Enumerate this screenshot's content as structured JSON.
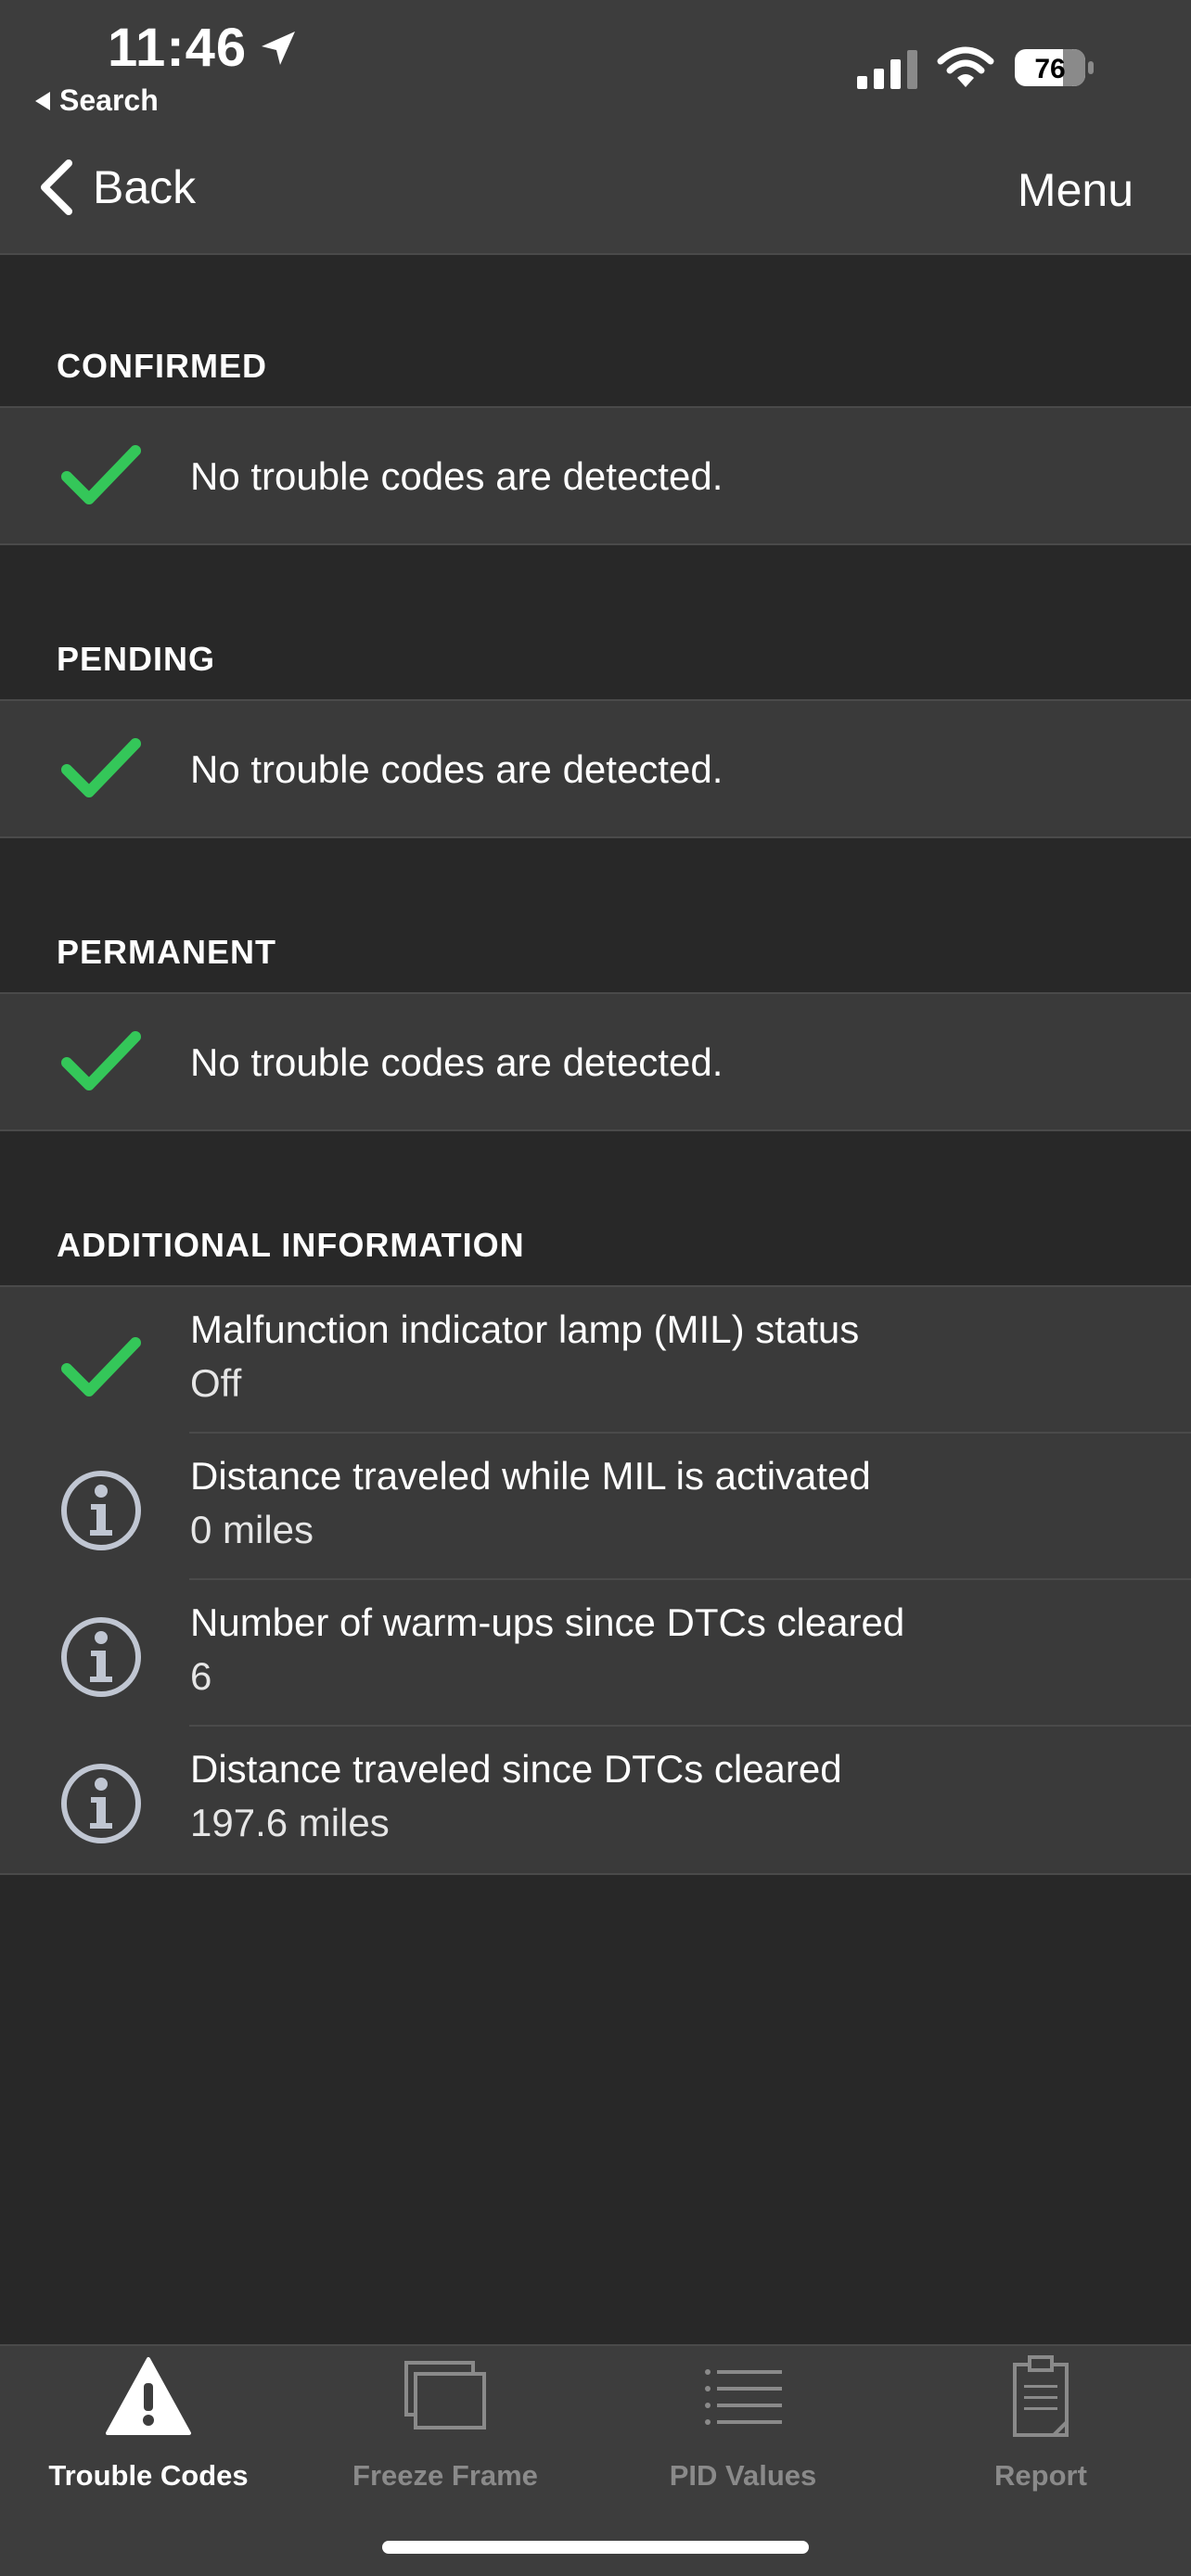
{
  "status_bar": {
    "time": "11:46",
    "back_app": "Search",
    "battery": "76"
  },
  "nav": {
    "back_label": "Back",
    "menu_label": "Menu"
  },
  "sections": {
    "confirmed": {
      "header": "CONFIRMED",
      "message": "No trouble codes are detected."
    },
    "pending": {
      "header": "PENDING",
      "message": "No trouble codes are detected."
    },
    "permanent": {
      "header": "PERMANENT",
      "message": "No trouble codes are detected."
    }
  },
  "additional": {
    "header": "ADDITIONAL INFORMATION",
    "items": [
      {
        "icon": "check-icon",
        "title": "Malfunction indicator lamp (MIL) status",
        "value": "Off"
      },
      {
        "icon": "info-icon",
        "title": "Distance traveled while MIL is activated",
        "value": "0 miles"
      },
      {
        "icon": "info-icon",
        "title": "Number of warm-ups since DTCs cleared",
        "value": "6"
      },
      {
        "icon": "info-icon",
        "title": "Distance traveled since DTCs cleared",
        "value": "197.6 miles"
      }
    ]
  },
  "tabs": [
    {
      "label": "Trouble Codes",
      "icon": "warning-icon",
      "active": true
    },
    {
      "label": "Freeze Frame",
      "icon": "frames-icon",
      "active": false
    },
    {
      "label": "PID Values",
      "icon": "list-icon",
      "active": false
    },
    {
      "label": "Report",
      "icon": "clipboard-icon",
      "active": false
    }
  ],
  "colors": {
    "check_green": "#34c759",
    "info_gray": "#c0c6d2",
    "background": "#282828",
    "row_background": "#3a3a3a"
  }
}
